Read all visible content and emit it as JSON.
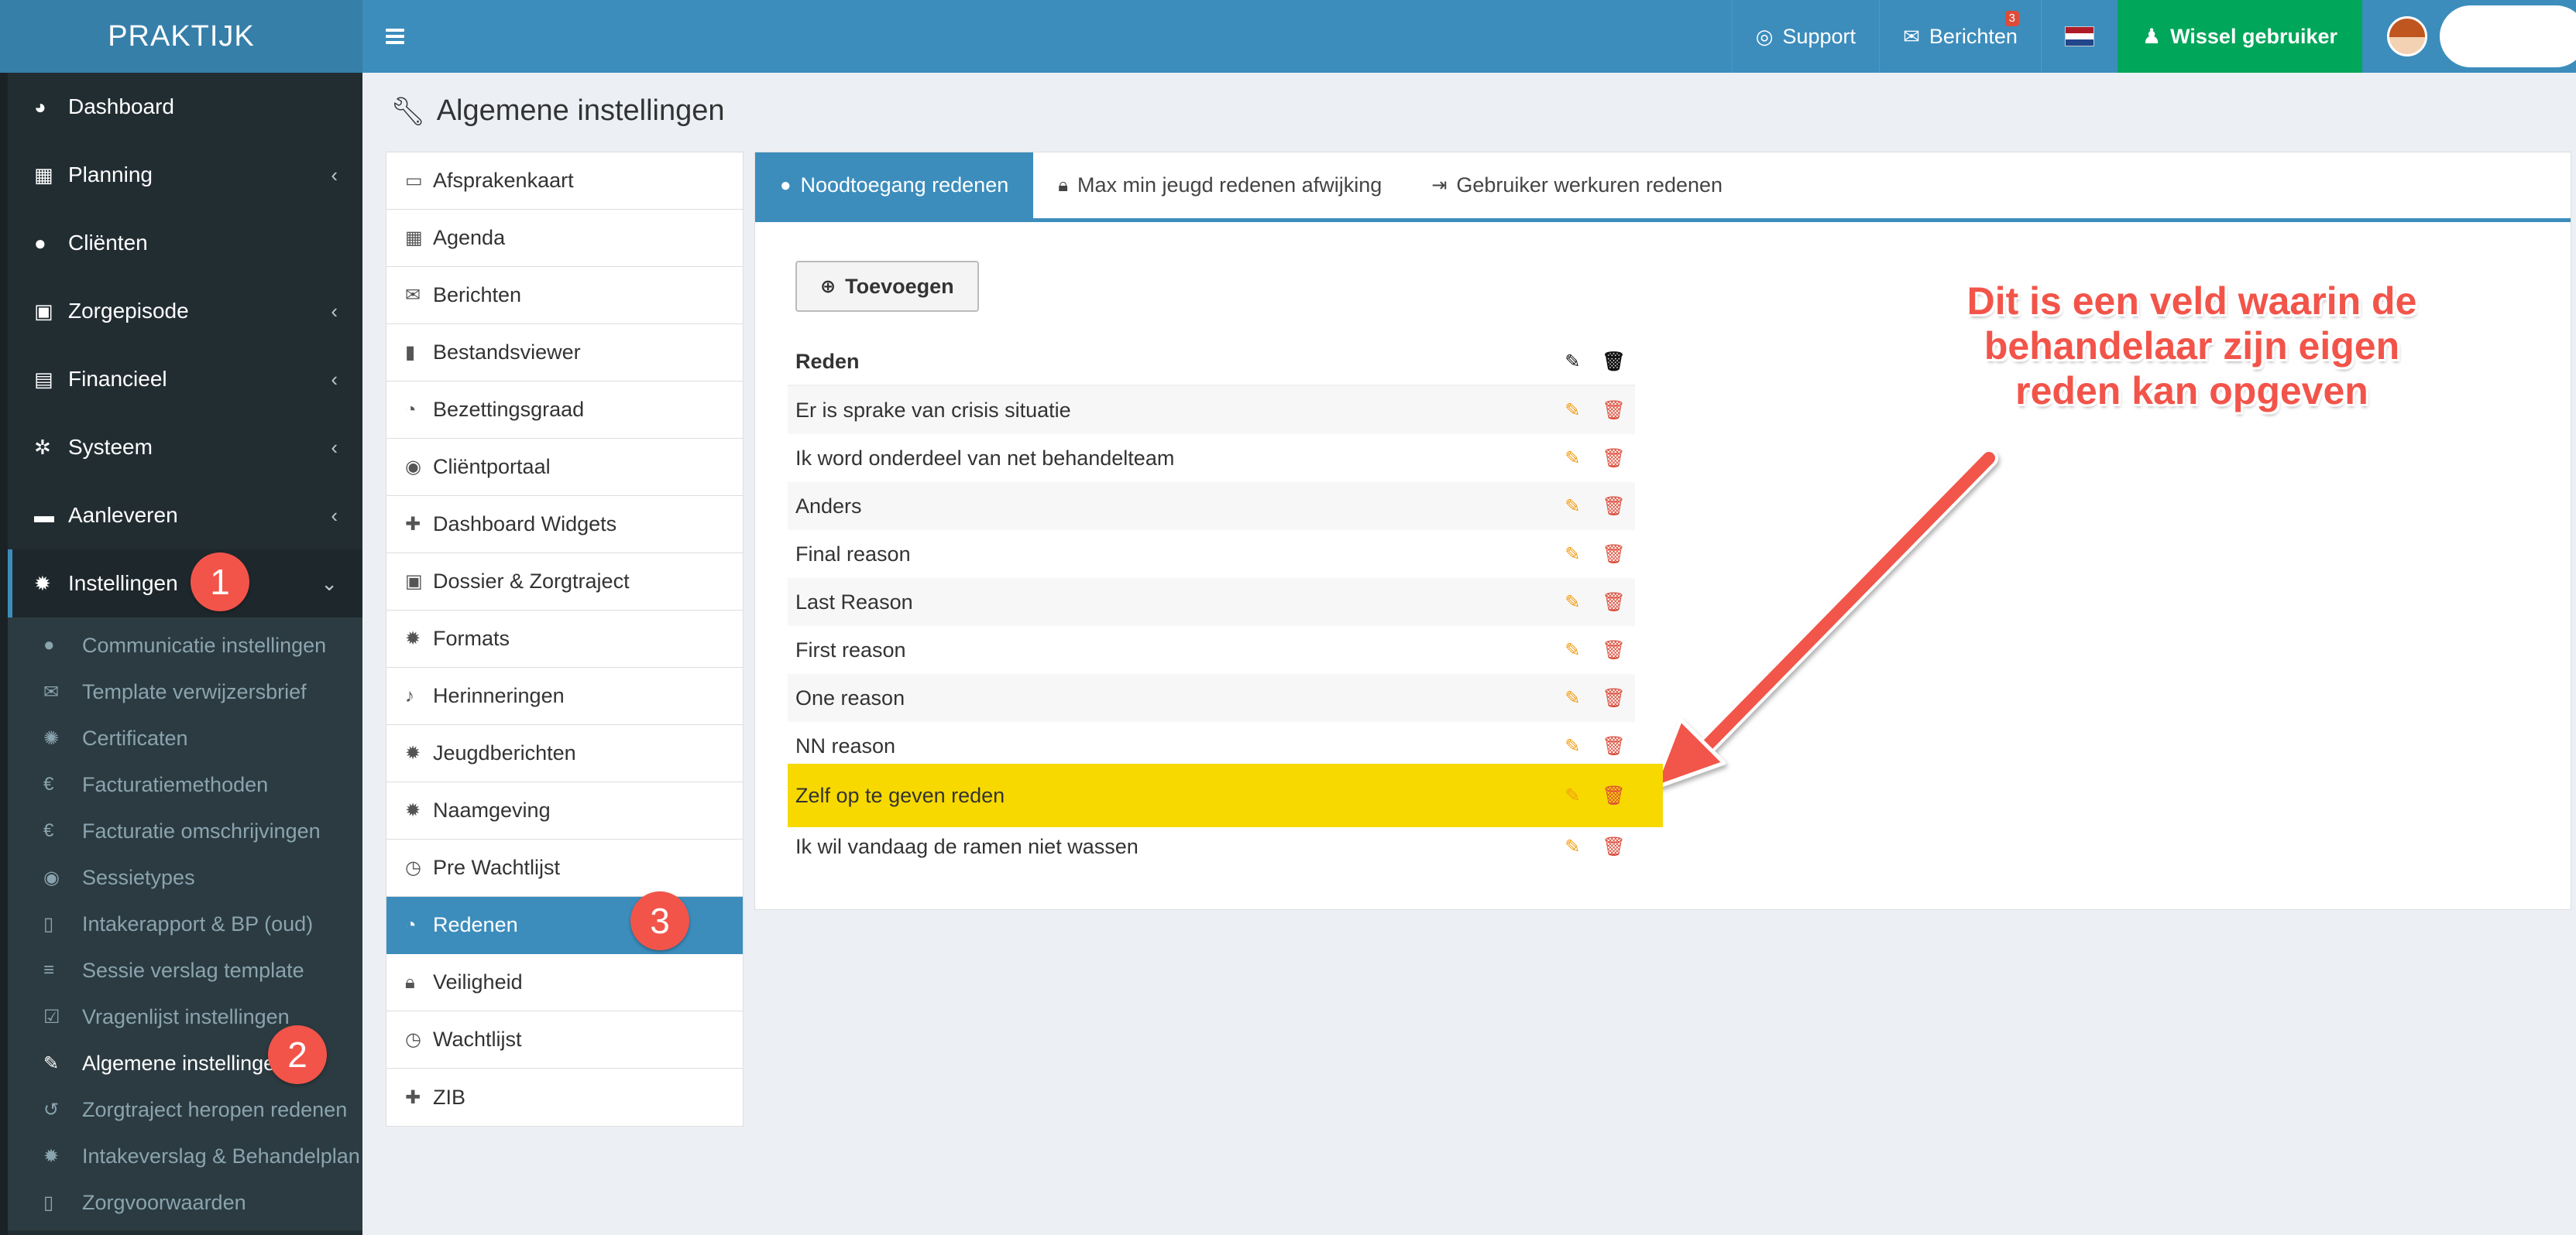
{
  "app": {
    "logo": "PRAKTIJK"
  },
  "topbar": {
    "support": "Support",
    "messages": "Berichten",
    "messages_count": "3",
    "switch_user": "Wissel gebruiker"
  },
  "sidebar": {
    "items": [
      {
        "label": "Dashboard",
        "icon": "dashboard-icon"
      },
      {
        "label": "Planning",
        "icon": "calendar-icon"
      },
      {
        "label": "Cliënten",
        "icon": "user-icon"
      },
      {
        "label": "Zorgepisode",
        "icon": "medkit-icon"
      },
      {
        "label": "Financieel",
        "icon": "book-icon"
      },
      {
        "label": "Systeem",
        "icon": "cogs-icon"
      },
      {
        "label": "Aanleveren",
        "icon": "truck-icon"
      },
      {
        "label": "Instellingen",
        "icon": "gear-icon"
      }
    ],
    "submenu": [
      "Communicatie instellingen",
      "Template verwijzersbrief",
      "Certificaten",
      "Facturatiemethoden",
      "Facturatie omschrijvingen",
      "Sessietypes",
      "Intakerapport & BP (oud)",
      "Sessie verslag template",
      "Vragenlijst instellingen",
      "Algemene instellingen",
      "Zorgtraject heropen redenen",
      "Intakeverslag & Behandelplan",
      "Zorgvoorwaarden"
    ]
  },
  "page": {
    "title": "Algemene instellingen"
  },
  "settings": {
    "items": [
      "Afsprakenkaart",
      "Agenda",
      "Berichten",
      "Bestandsviewer",
      "Bezettingsgraad",
      "Cliëntportaal",
      "Dashboard Widgets",
      "Dossier & Zorgtraject",
      "Formats",
      "Herinneringen",
      "Jeugdberichten",
      "Naamgeving",
      "Pre Wachtlijst",
      "Redenen",
      "Veiligheid",
      "Wachtlijst",
      "ZIB"
    ]
  },
  "tabs": [
    "Noodtoegang redenen",
    "Max min jeugd redenen afwijking",
    "Gebruiker werkuren redenen"
  ],
  "content": {
    "add_button": "Toevoegen",
    "column_header": "Reden",
    "rows": [
      "Er is sprake van crisis situatie",
      "Ik word onderdeel van net behandelteam",
      "Anders",
      "Final reason",
      "Last Reason",
      "First reason",
      "One reason",
      "NN reason",
      "Zelf op te geven reden",
      "Ik wil vandaag de ramen niet wassen"
    ]
  },
  "annotations": {
    "text_line1": "Dit is een veld waarin de",
    "text_line2": "behandelaar zijn eigen",
    "text_line3": "reden kan opgeven",
    "marker1": "1",
    "marker2": "2",
    "marker3": "3"
  },
  "colors": {
    "accent": "#3c8dbc",
    "sidebar": "#222d32",
    "success": "#00a65a",
    "highlight": "#f7d900",
    "annotation": "#f2544a"
  }
}
